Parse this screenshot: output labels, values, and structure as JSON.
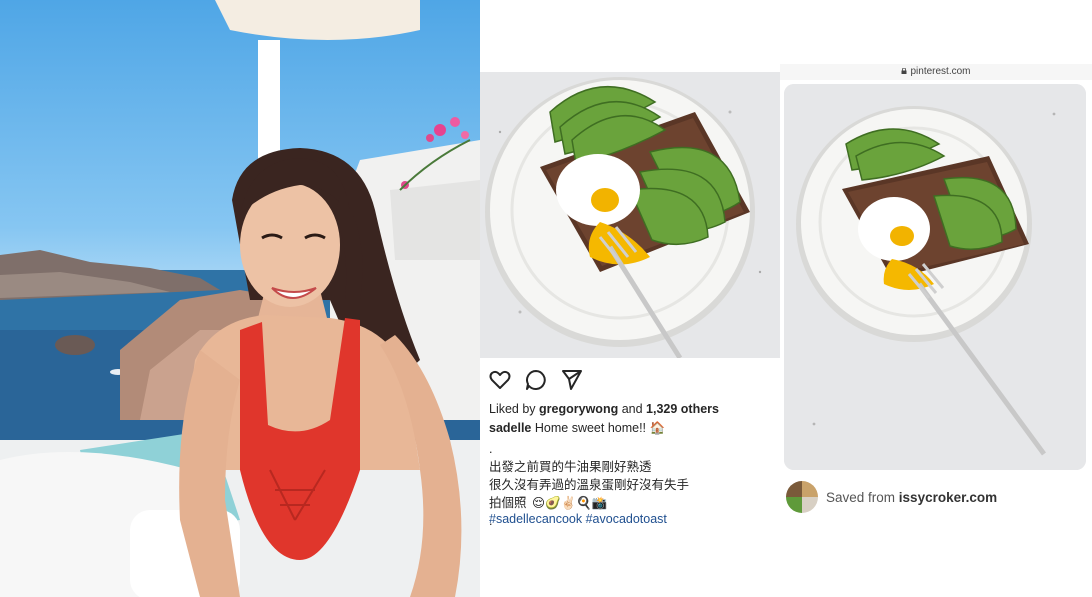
{
  "instagram": {
    "liked_by_prefix": "Liked by",
    "liked_by_user": "gregorywong",
    "liked_by_joiner": "and",
    "likes_count": "1,329 others",
    "caption_user": "sadelle",
    "caption_text": "Home sweet home!! 🏠",
    "dot1": ".",
    "line1": "出發之前買的牛油果剛好熟透",
    "line2": "很久沒有弄過的溫泉蛋剛好沒有失手",
    "line3": "拍個照",
    "line3_emojis": "😌🥑✌🏻🍳📸",
    "dot2": ".",
    "hashtags": "#sadellecancook #avocadotoast"
  },
  "pinterest": {
    "url": "pinterest.com",
    "saved_from_prefix": "Saved from",
    "saved_from_source": "issycroker.com"
  },
  "icons": {
    "like": "heart-icon",
    "comment": "comment-icon",
    "share": "send-icon",
    "lock": "lock-icon"
  },
  "colors": {
    "hashtag": "#1f4f8f",
    "swimsuit": "#e0362c",
    "avocado": "#5f9a3a",
    "yolk": "#f2b300"
  }
}
